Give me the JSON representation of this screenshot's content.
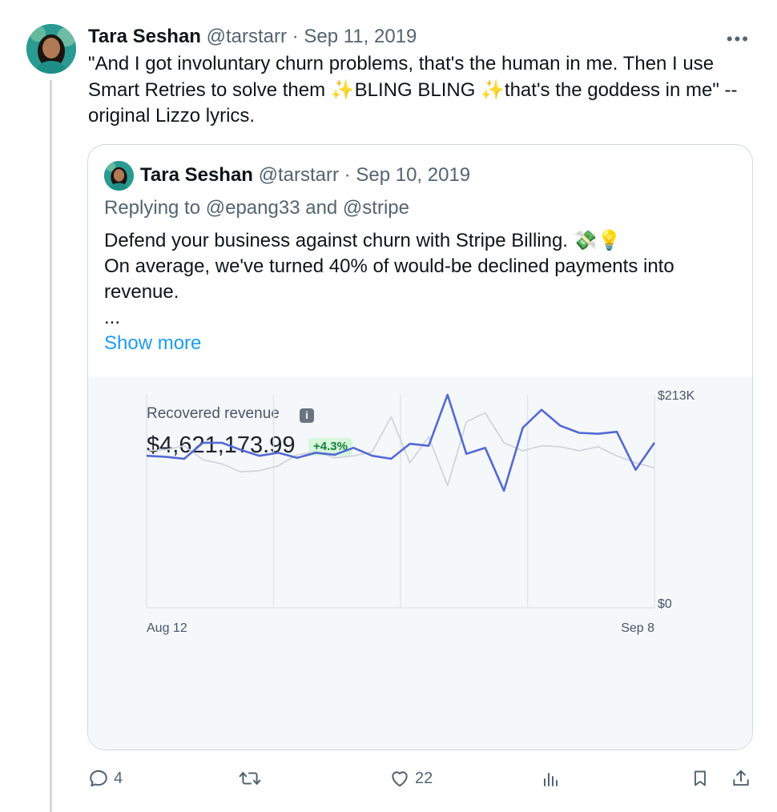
{
  "tweet": {
    "author_name": "Tara Seshan",
    "handle": "@tarstarr",
    "separator": "·",
    "date": "Sep 11, 2019",
    "more_label": "•••",
    "text": "\"And I got involuntary churn problems, that's the human in me. Then I use Smart Retries to solve them ✨BLING BLING ✨that's the goddess in me\" -- original Lizzo lyrics."
  },
  "quoted": {
    "author_name": "Tara Seshan",
    "handle": "@tarstarr",
    "separator": "·",
    "date": "Sep 10, 2019",
    "replying_prefix": "Replying to",
    "replying_to": "@epang33 and @stripe",
    "lines": [
      "Defend your business against churn with Stripe Billing. 💸💡",
      "On average, we've turned 40% of would-be declined payments into revenue.",
      "..."
    ],
    "show_more": "Show more"
  },
  "chart_data": {
    "type": "line",
    "title": "Recovered revenue",
    "value": "$4,621,173.99",
    "change": "+4.3%",
    "x_start_label": "Aug 12",
    "x_end_label": "Sep 8",
    "y_max_label": "$213K",
    "y_min_label": "$0",
    "ylim": [
      0,
      213
    ],
    "x": [
      "Aug 12",
      "Aug 13",
      "Aug 14",
      "Aug 15",
      "Aug 16",
      "Aug 17",
      "Aug 18",
      "Aug 19",
      "Aug 20",
      "Aug 21",
      "Aug 22",
      "Aug 23",
      "Aug 24",
      "Aug 25",
      "Aug 26",
      "Aug 27",
      "Aug 28",
      "Aug 29",
      "Aug 30",
      "Aug 31",
      "Sep 1",
      "Sep 2",
      "Sep 3",
      "Sep 4",
      "Sep 5",
      "Sep 6",
      "Sep 7",
      "Sep 8"
    ],
    "series": [
      {
        "color": "#5469d4",
        "values": [
          152,
          151,
          149,
          165,
          165,
          158,
          152,
          155,
          150,
          155,
          153,
          160,
          152,
          149,
          164,
          162,
          213,
          154,
          160,
          117,
          180,
          198,
          182,
          175,
          174,
          176,
          138,
          165
        ]
      },
      {
        "color": "#d0d4dc",
        "values": [
          157,
          158,
          162,
          148,
          144,
          136,
          137,
          142,
          153,
          156,
          150,
          152,
          156,
          191,
          145,
          171,
          122,
          186,
          195,
          165,
          157,
          162,
          161,
          157,
          161,
          152,
          145,
          140
        ]
      }
    ],
    "grid": true
  },
  "actions": {
    "replies": "4",
    "reposts": "",
    "likes": "22"
  },
  "colors": {
    "link": "#1d9bf0",
    "muted": "#536471",
    "accent_line": "#5469d4",
    "compare_line": "#d0d4dc",
    "badge_bg": "#d7f7dc",
    "badge_text": "#15803d"
  }
}
